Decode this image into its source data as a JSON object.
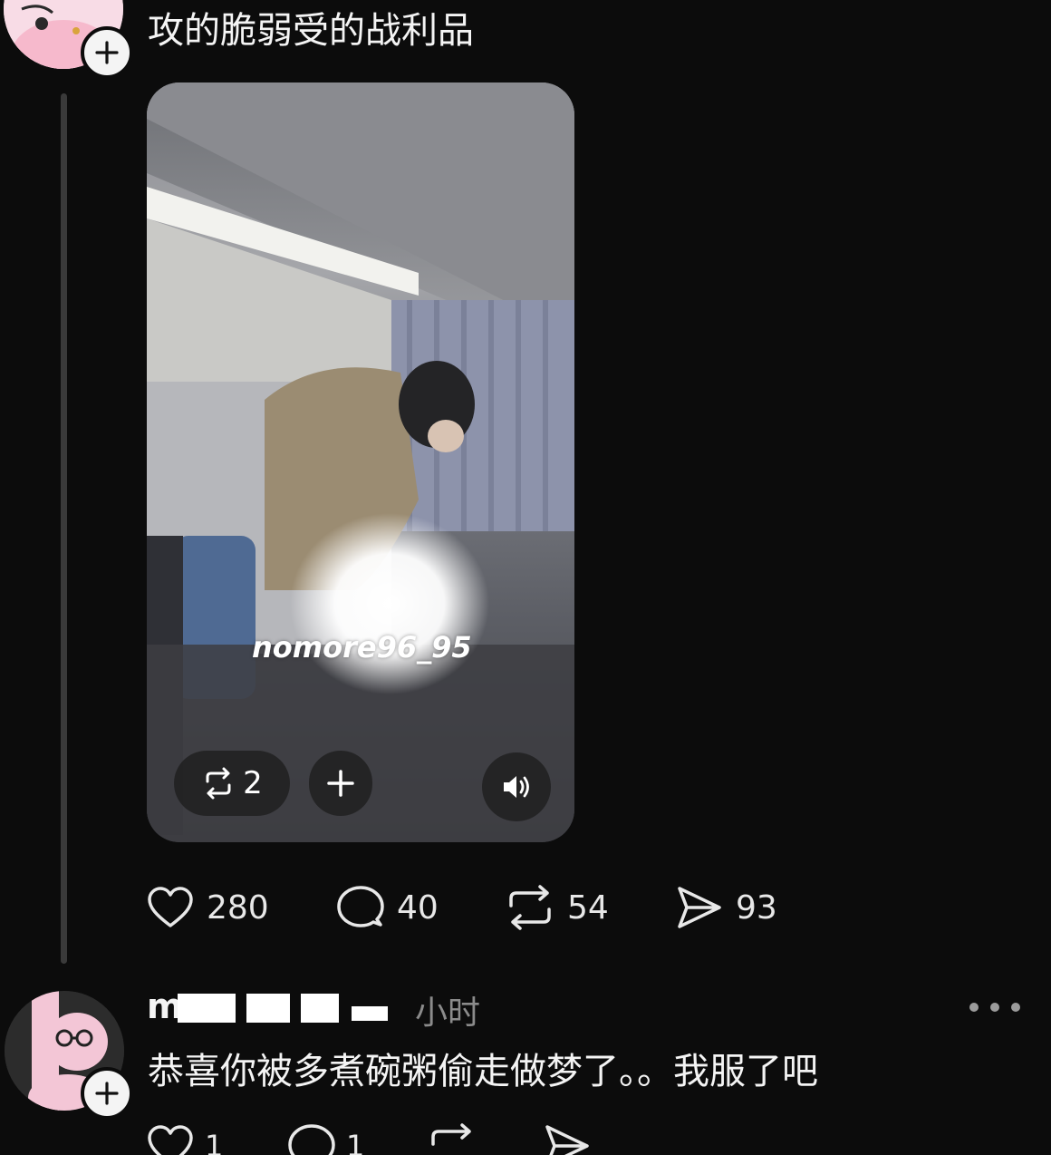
{
  "post": {
    "text": "攻的脆弱受的战利品",
    "avatar_icon": "pink-cartoon-avatar",
    "follow_icon": "plus-icon",
    "video": {
      "watermark": "nomore96_95",
      "repost_count": "2",
      "add_icon": "plus-icon",
      "sound_icon": "speaker-icon"
    },
    "stats": {
      "likes": "280",
      "comments": "40",
      "reposts": "54",
      "shares": "93"
    }
  },
  "reply": {
    "username_visible": "m",
    "time": "小时",
    "text": "恭喜你被多煮碗粥偷走做梦了。。我服了吧",
    "avatar_icon": "cartoon-glasses-avatar",
    "follow_icon": "plus-icon",
    "more_icon": "more-dots-icon",
    "stats": {
      "likes": "1",
      "comments": "1"
    }
  },
  "colors": {
    "background": "#0c0c0c",
    "text": "#f4f4f4",
    "muted": "#8b8b8b",
    "thread_line": "#3a3a3a"
  }
}
